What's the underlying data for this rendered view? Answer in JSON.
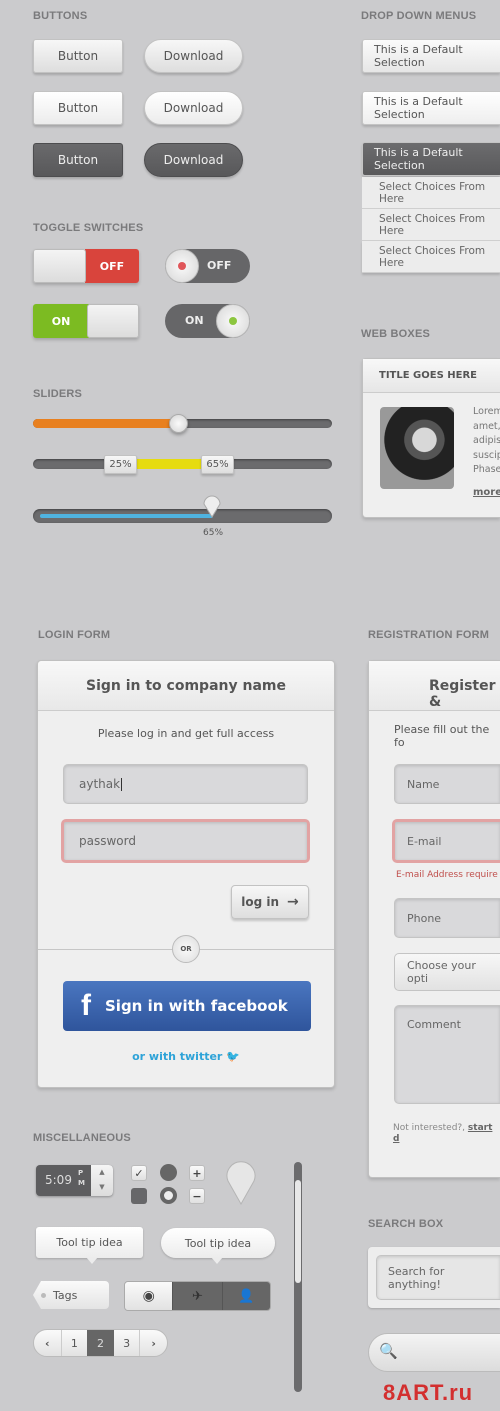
{
  "sections": {
    "buttons": "BUTTONS",
    "dropdowns": "DROP DOWN MENUS",
    "toggles": "TOGGLE SWITCHES",
    "web_boxes": "WEB BOXES",
    "sliders": "SLIDERS",
    "login": "LOGIN FORM",
    "registration": "REGISTRATION FORM",
    "misc": "MISCELLANEOUS",
    "search": "SEARCH BOX"
  },
  "buttons": {
    "rect": "Button",
    "pill": "Download"
  },
  "dropdowns": {
    "default": "This is a Default Selection",
    "options": [
      "Select Choices From Here",
      "Select Choices From Here",
      "Select Choices From Here"
    ]
  },
  "toggles": {
    "off": "OFF",
    "on": "ON"
  },
  "colors": {
    "orange": "#e8801f",
    "yellow": "#e6dc10",
    "blue": "#4fb3e0",
    "red": "#d9443c",
    "green": "#7cbb22",
    "facebook": "#3b62a8",
    "twitter": "#2ea3d8",
    "error": "#c0504d"
  },
  "sliders": {
    "single_value": 48,
    "range_low": "25%",
    "range_high": "65%",
    "progress_label": "65%",
    "progress_value": 65
  },
  "web_box": {
    "title": "TITLE GOES HERE",
    "lines": [
      "Lorem",
      "amet,",
      "adipis",
      "suscip",
      "Phase"
    ],
    "more": "more"
  },
  "login": {
    "title": "Sign in to company name",
    "subtitle": "Please log in and get full access",
    "username": "aythak",
    "password_placeholder": "password",
    "login_button": "log in",
    "or": "OR",
    "facebook": "Sign in with facebook",
    "twitter": "or with twitter"
  },
  "registration": {
    "title": "Register &",
    "subtitle": "Please fill out the fo",
    "name": "Name",
    "email": "E-mail",
    "email_error": "E-mail Address require",
    "phone": "Phone",
    "choose": "Choose your opti",
    "comment": "Comment",
    "not_interested": "Not interested?,",
    "start": "start d"
  },
  "misc": {
    "time": "5:09",
    "ampm_p": "P",
    "ampm_m": "M",
    "tooltip1": "Tool tip idea",
    "tooltip2": "Tool tip idea",
    "tags": "Tags",
    "pages": [
      "1",
      "2",
      "3"
    ],
    "current_page": "2"
  },
  "search": {
    "placeholder": "Search for anything!"
  },
  "watermark": "8ART.ru"
}
